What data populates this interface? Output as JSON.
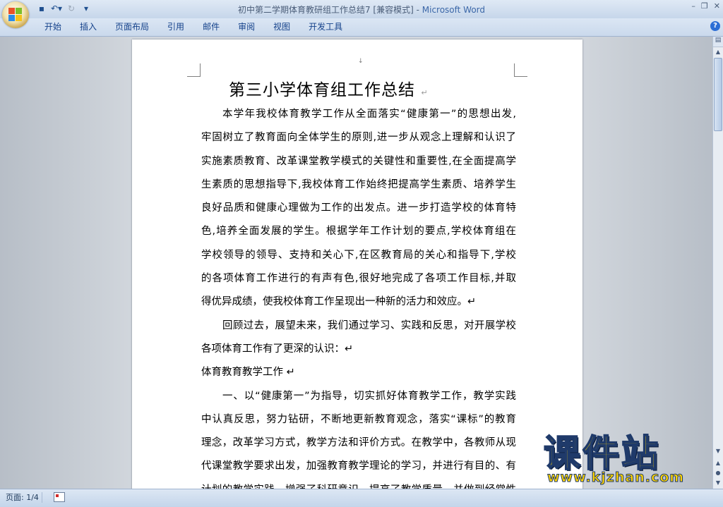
{
  "window": {
    "doc_title": "初中第二学期体育教研组工作总结7 [兼容模式]",
    "separator": " - ",
    "app_name": "Microsoft Word",
    "controls": [
      "–",
      "❐",
      "✕"
    ]
  },
  "quick_access": {
    "icons": [
      "save-icon",
      "undo-icon",
      "redo-icon",
      "customize-icon"
    ],
    "glyphs": [
      "▪",
      "↶▾",
      "↻",
      "▾"
    ]
  },
  "ribbon": {
    "tabs": [
      "开始",
      "插入",
      "页面布局",
      "引用",
      "邮件",
      "审阅",
      "视图",
      "开发工具"
    ],
    "help": "?"
  },
  "document": {
    "header_mark": "↓",
    "heading": "第三小学体育组工作总结",
    "paragraph_mark": "↵",
    "lines": [
      {
        "text": "本学年我校体育教学工作从全面落实“健康第一”的思想出发,",
        "indent": true,
        "last": false
      },
      {
        "text": "牢固树立了教育面向全体学生的原则,进一步从观念上理解和认识了",
        "indent": false,
        "last": false
      },
      {
        "text": "实施素质教育、改革课堂教学模式的关键性和重要性,在全面提高学",
        "indent": false,
        "last": false
      },
      {
        "text": "生素质的思想指导下,我校体育工作始终把提高学生素质、培养学生",
        "indent": false,
        "last": false
      },
      {
        "text": "良好品质和健康心理做为工作的出发点。进一步打造学校的体育特",
        "indent": false,
        "last": false
      },
      {
        "text": "色,培养全面发展的学生。根据学年工作计划的要点,学校体育组在",
        "indent": false,
        "last": false
      },
      {
        "text": "学校领导的领导、支持和关心下,在区教育局的关心和指导下,学校",
        "indent": false,
        "last": false
      },
      {
        "text": "的各项体育工作进行的有声有色,很好地完成了各项工作目标,并取",
        "indent": false,
        "last": false
      },
      {
        "text": "得优异成绩，使我校体育工作呈现出一种新的活力和效应。↵",
        "indent": false,
        "last": true
      },
      {
        "text": "回顾过去，展望未来，我们通过学习、实践和反思，对开展学校",
        "indent": true,
        "last": false
      },
      {
        "text": "各项体育工作有了更深的认识：↵",
        "indent": false,
        "last": true
      },
      {
        "text": "体育教育教学工作                    ↵",
        "indent": false,
        "last": true
      },
      {
        "text": "一、以“健康第一”为指导，切实抓好体育教学工作，教学实践",
        "indent": true,
        "last": false
      },
      {
        "text": "中认真反思，努力钻研，不断地更新教育观念，落实“课标”的教育",
        "indent": false,
        "last": false
      },
      {
        "text": "理念，改革学习方式，教学方法和评价方式。在教学中，各教师从现",
        "indent": false,
        "last": false
      },
      {
        "text": "代课堂教学要求出发，加强教育教学理论的学习，并进行有目的、有",
        "indent": false,
        "last": false
      },
      {
        "text": "计划的教学实践，增强了科研意识，提高了教学质量，并做到经常性",
        "indent": false,
        "last": false
      }
    ]
  },
  "scrollbar": {
    "ruler_glyph": "▤",
    "up": "▲",
    "down": "▼",
    "nav": [
      "▲",
      "●",
      "▼"
    ]
  },
  "status": {
    "page": "页面: 1/4"
  },
  "watermark": {
    "main": "课件站",
    "url": "www.kjzhan.com"
  }
}
